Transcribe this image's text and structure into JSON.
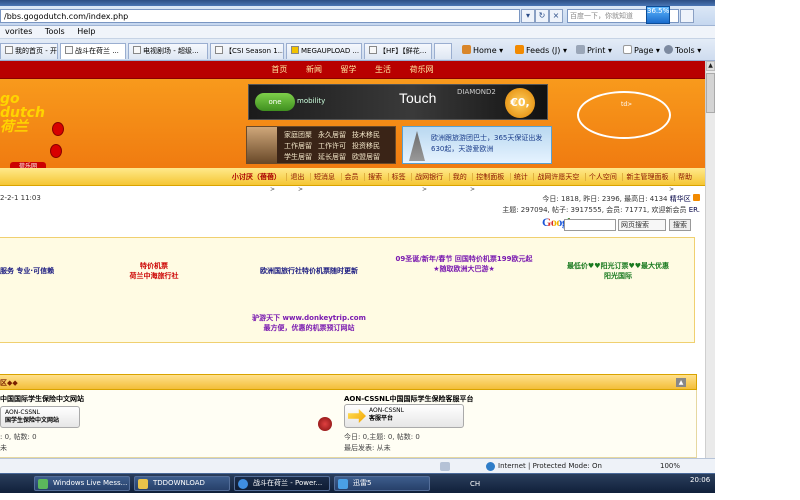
{
  "browser": {
    "address_url": "/bbs.gogodutch.com/index.php",
    "search_placeholder": "百度一下，你就知道",
    "cpu_meter": "36.5%",
    "menu": [
      "vorites",
      "Tools",
      "Help"
    ],
    "tabs": [
      "我的首页 - 开心...",
      "战斗在荷兰 ...",
      "电视剧场 - 超级...",
      "【CSI Season 1...",
      "MEGAUPLOAD ...",
      "【HF】【鲜花..."
    ],
    "toolbar": {
      "home": "Home",
      "feeds": "Feeds (J)",
      "print": "Print",
      "page": "Page",
      "tools": "Tools"
    },
    "status": {
      "zone": "Internet | Protected Mode: On",
      "zoom": "100%"
    }
  },
  "site": {
    "top_nav": [
      "首页",
      "新闻",
      "留学",
      "生活",
      "荷乐网"
    ],
    "logo": {
      "text": "go\ndutch\n荷兰",
      "badge": "荷乐网"
    },
    "ads": {
      "one_label": "one",
      "mobility": "mobility",
      "touch": "Touch",
      "diamond": "DIAMOND2",
      "euro": "€0,",
      "td_label": "td>",
      "immigration": [
        "家庭团聚",
        "永久居留",
        "技术移民",
        "工作居留",
        "工作许可",
        "投资移民",
        "学生居留",
        "延长居留",
        "欧盟居留"
      ],
      "europe_line1": "欧洲跟旅游团巴士，365天保证出发",
      "europe_line2": "630起，天游爱欧洲"
    },
    "sub_nav": [
      "小讨厌（蓓蓓）",
      "退出",
      "短消息",
      "会员",
      "搜索",
      "标签",
      "战网银行",
      "我的",
      "控制面板",
      "统计",
      "战网许愿天空",
      "个人空间",
      "新主管理面板",
      "帮助"
    ],
    "sub_nav_arrows": [
      ">",
      ">",
      ">",
      ">",
      ">"
    ],
    "date": "2-2-1 11:03",
    "stats": {
      "line1": "今日: 1818, 昨日: 2396, 最高日: 4134",
      "line1_link": "精华区",
      "line2": "主题: 297094, 帖子: 3917555, 会员: 71771, 欢迎新会员",
      "line2_link": "ER."
    },
    "google": {
      "logo": "Google",
      "select": "网页搜索",
      "button": "搜索"
    },
    "ad_links": {
      "a1": "服务 专业·可信赖",
      "a2a": "特价机票",
      "a2b": "荷兰中海旅行社",
      "a3": "欧洲国旅行社特价机票随时更新",
      "a4a": "09圣诞/新年/春节 回国特价机票199欧元起",
      "a4b": "★随取欧洲大巴游★",
      "a5a": "最低价♥♥阳光订票♥♥最大优惠",
      "a5b": "阳光国际",
      "a6a": "驴游天下 www.donkeytrip.com",
      "a6b": "最方便，优惠的机票预订网站"
    },
    "forum": {
      "header": "区◆◆",
      "left_title": "中国国际学生保险中文网站",
      "left_btn_line1": "AON-CSSNL",
      "left_btn_line2": "国学生保险中文网站",
      "left_meta1": ": 0, 帖数: 0",
      "left_meta2": "未",
      "right_title": "AON-CSSNL中国国际学生保险客服平台",
      "right_btn_line1": "AON-CSSNL",
      "right_btn_line2": "客服平台",
      "right_meta1": "今日: 0,主题: 0, 帖数: 0",
      "right_meta2": "最后发表: 从未"
    }
  },
  "taskbar": {
    "tasks": [
      "Windows Live Mess...",
      "TDDOWNLOAD",
      "战斗在荷兰 - Power...",
      "迅雷5"
    ],
    "tray_lang": "CH",
    "clock": "20:06"
  }
}
